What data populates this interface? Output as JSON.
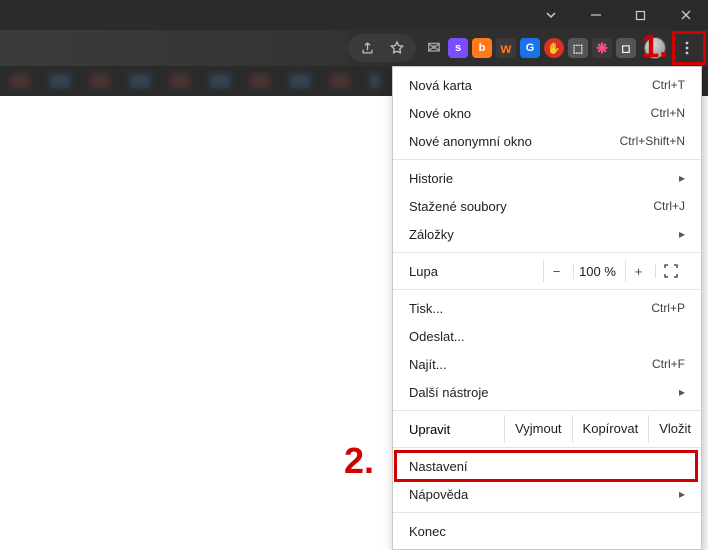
{
  "titlebar": {
    "tab_dropdown_icon": "chevron-down",
    "minimize_icon": "minimize",
    "maximize_icon": "maximize",
    "close_icon": "close"
  },
  "toolbar": {
    "share_icon": "share",
    "bookmark_icon": "star",
    "extensions": [
      {
        "name": "mail-icon",
        "glyph": "✉"
      },
      {
        "name": "ext-s-icon",
        "glyph": "s"
      },
      {
        "name": "ext-b-icon",
        "glyph": "b"
      },
      {
        "name": "ext-w-icon",
        "glyph": "w"
      },
      {
        "name": "ext-g-icon",
        "glyph": "G"
      },
      {
        "name": "ext-block-icon",
        "glyph": "✋"
      },
      {
        "name": "ext-grey-icon",
        "glyph": "⬚"
      },
      {
        "name": "ext-pink-icon",
        "glyph": "❋"
      },
      {
        "name": "ext-white-icon",
        "glyph": "◻"
      }
    ],
    "avatar": "user-avatar",
    "kebab_icon": "more-vert"
  },
  "menu": {
    "new_tab": {
      "label": "Nová karta",
      "shortcut": "Ctrl+T"
    },
    "new_window": {
      "label": "Nové okno",
      "shortcut": "Ctrl+N"
    },
    "new_incognito": {
      "label": "Nové anonymní okno",
      "shortcut": "Ctrl+Shift+N"
    },
    "history": {
      "label": "Historie"
    },
    "downloads": {
      "label": "Stažené soubory",
      "shortcut": "Ctrl+J"
    },
    "bookmarks": {
      "label": "Záložky"
    },
    "zoom": {
      "label": "Lupa",
      "minus": "−",
      "value": "100 %",
      "plus": "+",
      "fullscreen_icon": "fullscreen"
    },
    "print": {
      "label": "Tisk...",
      "shortcut": "Ctrl+P"
    },
    "cast": {
      "label": "Odeslat..."
    },
    "find": {
      "label": "Najít...",
      "shortcut": "Ctrl+F"
    },
    "more_tools": {
      "label": "Další nástroje"
    },
    "edit": {
      "label": "Upravit",
      "cut": "Vyjmout",
      "copy": "Kopírovat",
      "paste": "Vložit"
    },
    "settings": {
      "label": "Nastavení"
    },
    "help": {
      "label": "Nápověda"
    },
    "exit": {
      "label": "Konec"
    }
  },
  "annotations": {
    "one": "1.",
    "two": "2."
  }
}
